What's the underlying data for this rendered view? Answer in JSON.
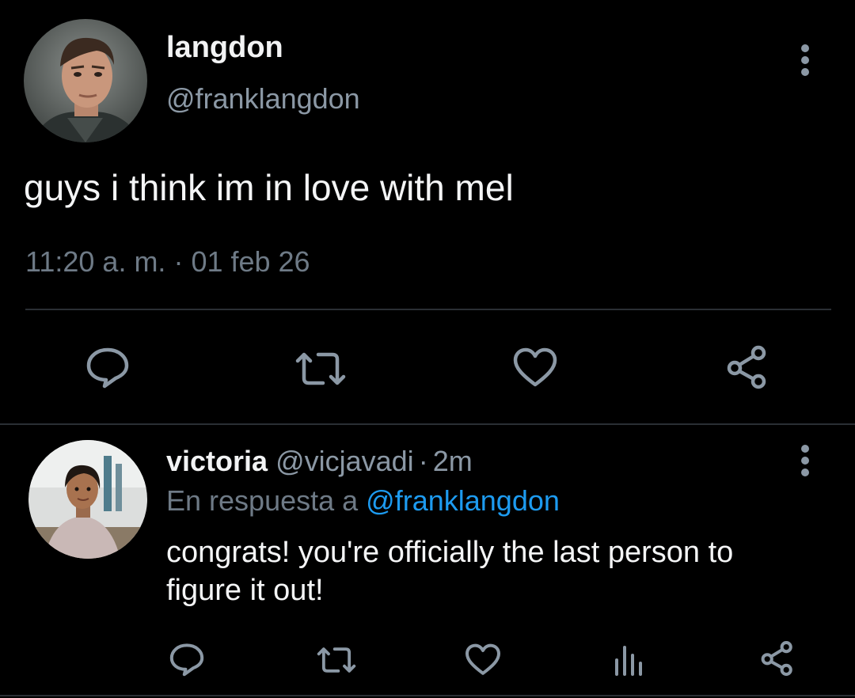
{
  "main_tweet": {
    "name": "langdon",
    "handle": "@franklangdon",
    "text": "guys i think im in love with mel",
    "time": "11:20 a. m.",
    "separator": "·",
    "date": "01 feb 26",
    "actions": [
      "reply-icon",
      "retweet-icon",
      "like-icon",
      "share-icon"
    ]
  },
  "reply_tweet": {
    "name": "victoria",
    "handle": "@vicjavadi",
    "separator": "·",
    "time": "2m",
    "reply_prefix": "En respuesta a",
    "reply_mention": "@franklangdon",
    "text": "congrats! you're officially the last person to figure it out!",
    "actions": [
      "reply-icon",
      "retweet-icon",
      "like-icon",
      "views-icon",
      "share-icon"
    ]
  },
  "colors": {
    "background": "#000000",
    "primary_text": "#f4f5f6",
    "secondary_text": "#8b98a5",
    "muted_text": "#6e7a86",
    "link": "#1d9bf0",
    "icon": "#8b98a5",
    "divider": "#2a2f34"
  }
}
